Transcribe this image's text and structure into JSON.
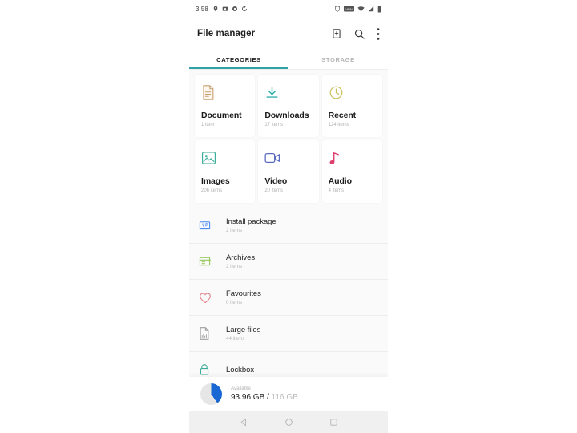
{
  "status_bar": {
    "clock": "3:58",
    "left_icons": [
      "location-icon",
      "photo-icon",
      "settings-icon",
      "sync-icon"
    ],
    "right_icons": [
      "shield-icon",
      "vpn-badge-icon",
      "wifi-icon",
      "signal-icon",
      "battery-icon"
    ],
    "vpn_label": "VPN"
  },
  "toolbar": {
    "title": "File manager",
    "actions": [
      "add-file-icon",
      "search-icon",
      "overflow-menu-icon"
    ]
  },
  "tabs": [
    {
      "label": "CATEGORIES",
      "active": true
    },
    {
      "label": "STORAGE",
      "active": false
    }
  ],
  "categories": [
    {
      "name": "Document",
      "count": "1 item",
      "icon": "document-icon",
      "color": "#c9a070"
    },
    {
      "name": "Downloads",
      "count": "17 items",
      "icon": "download-icon",
      "color": "#35b0ac"
    },
    {
      "name": "Recent",
      "count": "124 items",
      "icon": "clock-icon",
      "color": "#c9c05a"
    },
    {
      "name": "Images",
      "count": "206 items",
      "icon": "image-icon",
      "color": "#3dae9a"
    },
    {
      "name": "Video",
      "count": "20 items",
      "icon": "video-icon",
      "color": "#5b6bc0"
    },
    {
      "name": "Audio",
      "count": "4 items",
      "icon": "audio-icon",
      "color": "#e0416f"
    }
  ],
  "list_items": [
    {
      "name": "Install package",
      "count": "2 items",
      "icon": "apk-icon",
      "color": "#4285f4"
    },
    {
      "name": "Archives",
      "count": "2 items",
      "icon": "archive-icon",
      "color": "#8bc34a"
    },
    {
      "name": "Favourites",
      "count": "0 items",
      "icon": "heart-icon",
      "color": "#e0838a"
    },
    {
      "name": "Large files",
      "count": "44 items",
      "icon": "large-file-icon",
      "color": "#9e9e9e"
    },
    {
      "name": "Lockbox",
      "count": "",
      "icon": "lock-icon",
      "color": "#3dae9a"
    }
  ],
  "storage": {
    "label": "Available",
    "available": "93.96 GB",
    "separator": " / ",
    "total": "116 GB",
    "used_percent": 40,
    "accent_color": "#1967d2"
  },
  "nav_bar": {
    "back": "back-icon",
    "home": "home-icon",
    "recents": "recents-icon"
  }
}
